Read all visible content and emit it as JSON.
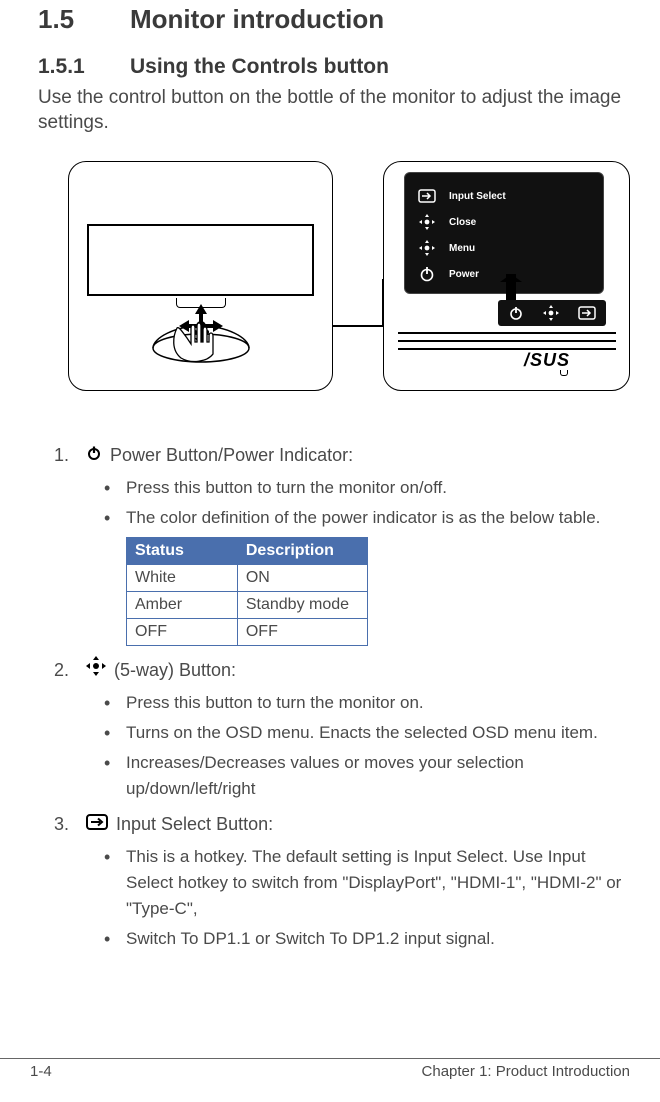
{
  "section": {
    "num": "1.5",
    "title": "Monitor introduction"
  },
  "subsection": {
    "num": "1.5.1",
    "title": "Using the Controls button"
  },
  "lead": "Use the control button on the bottle of the monitor to adjust the image settings.",
  "osd": {
    "items": [
      {
        "label": "Input Select"
      },
      {
        "label": "Close"
      },
      {
        "label": "Menu"
      },
      {
        "label": "Power"
      }
    ]
  },
  "asus_logo": "/SUS",
  "list": {
    "item1": {
      "title": " Power Button/Power Indicator:",
      "b1": "Press this button to turn the monitor on/off.",
      "b2": "The color definition of the power indicator is as the below table."
    },
    "table": {
      "h1": "Status",
      "h2": "Description",
      "rows": [
        {
          "c1": "White",
          "c2": "ON"
        },
        {
          "c1": "Amber",
          "c2": "Standby mode"
        },
        {
          "c1": "OFF",
          "c2": "OFF"
        }
      ]
    },
    "item2": {
      "title": " (5-way) Button:",
      "b1": "Press this button to turn the monitor on.",
      "b2": "Turns on the OSD menu. Enacts the selected OSD menu item.",
      "b3": "Increases/Decreases values or moves your selection up/down/left/right"
    },
    "item3": {
      "title": " Input Select Button:",
      "b1": "This is a hotkey. The default setting is Input Select. Use Input Select hotkey to switch from \"DisplayPort\", \"HDMI-1\", \"HDMI-2\" or \"Type-C\",",
      "b2": "Switch To DP1.1 or Switch To DP1.2 input signal."
    }
  },
  "footer": {
    "left": "1-4",
    "right": "Chapter 1: Product Introduction"
  }
}
